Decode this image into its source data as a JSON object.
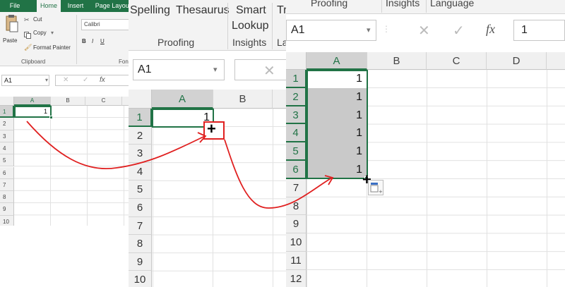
{
  "panel1": {
    "tabs": [
      {
        "label": "File"
      },
      {
        "label": "Home"
      },
      {
        "label": "Insert"
      },
      {
        "label": "Page Layout"
      }
    ],
    "ribbon": {
      "paste": "Paste",
      "cut": "Cut",
      "copy": "Copy",
      "format_painter": "Format Painter",
      "clipboard": "Clipboard",
      "font_name": "Calibri",
      "font_group": "Fon",
      "bold": "B",
      "italic": "I",
      "underline": "U"
    },
    "name_box": "A1",
    "fx": "fx",
    "columns": [
      "A",
      "B",
      "C"
    ],
    "rows": [
      "1",
      "2",
      "3",
      "4",
      "5",
      "6",
      "7",
      "8",
      "9",
      "10"
    ],
    "cell_a1": "1"
  },
  "panel2": {
    "ribbon": {
      "spelling": "Spelling",
      "thesaurus": "Thesaurus",
      "smart": "Smart",
      "lookup": "Lookup",
      "tr": "Tr",
      "proofing": "Proofing",
      "insights": "Insights",
      "la": "La"
    },
    "name_box": "A1",
    "columns": [
      "A",
      "B"
    ],
    "rows": [
      "1",
      "2",
      "3",
      "4",
      "5",
      "6",
      "7",
      "8",
      "9",
      "10"
    ],
    "cell_a1": "1"
  },
  "panel3": {
    "ribbon": {
      "proofing": "Proofing",
      "insights": "Insights",
      "language": "Language"
    },
    "name_box": "A1",
    "fx": "fx",
    "formula_value": "1",
    "columns": [
      "A",
      "B",
      "C",
      "D"
    ],
    "rows": [
      "1",
      "2",
      "3",
      "4",
      "5",
      "6",
      "7",
      "8",
      "9",
      "10",
      "11",
      "12"
    ],
    "values": [
      "1",
      "1",
      "1",
      "1",
      "1",
      "1"
    ]
  },
  "colors": {
    "excel_green": "#217346",
    "arrow_red": "#e02020",
    "selection_fill": "#c9c9c9"
  },
  "icons": [
    "cut-icon",
    "copy-icon",
    "format-painter-icon",
    "paste-icon",
    "fill-handle-cursor-icon",
    "autofill-options-icon",
    "cancel-icon",
    "enter-icon"
  ]
}
